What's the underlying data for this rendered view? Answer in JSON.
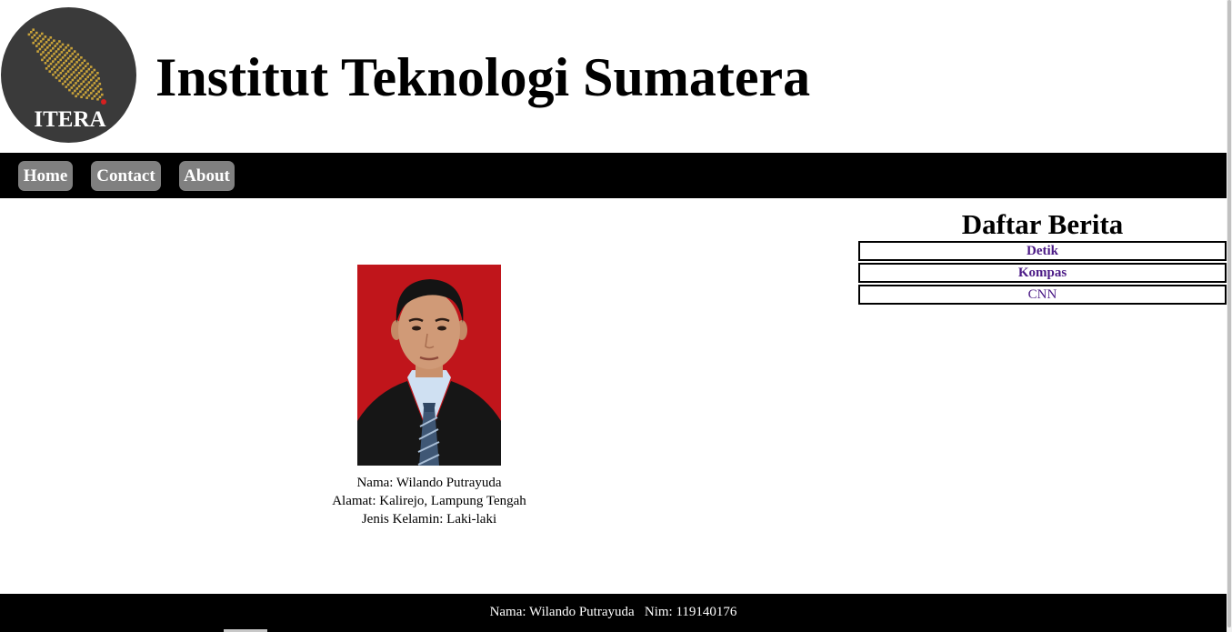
{
  "header": {
    "logo_text": "ITERA",
    "title": "Institut Teknologi Sumatera"
  },
  "nav": {
    "items": [
      {
        "label": "Home"
      },
      {
        "label": "Contact"
      },
      {
        "label": "About"
      }
    ]
  },
  "profile": {
    "name_line": "Nama: Wilando Putrayuda",
    "address_line": "Alamat: Kalirejo, Lampung Tengah",
    "gender_line": "Jenis Kelamin: Laki-laki"
  },
  "news": {
    "title": "Daftar Berita",
    "items": [
      {
        "label": "Detik"
      },
      {
        "label": "Kompas"
      },
      {
        "label": "CNN"
      }
    ]
  },
  "footer": {
    "text": "Nama: Wilando Putrayuda   Nim: 119140176"
  },
  "colors": {
    "nav_bg": "#000000",
    "nav_button": "#808080",
    "link": "#4b1a86",
    "photo_bg": "#c0151b"
  }
}
